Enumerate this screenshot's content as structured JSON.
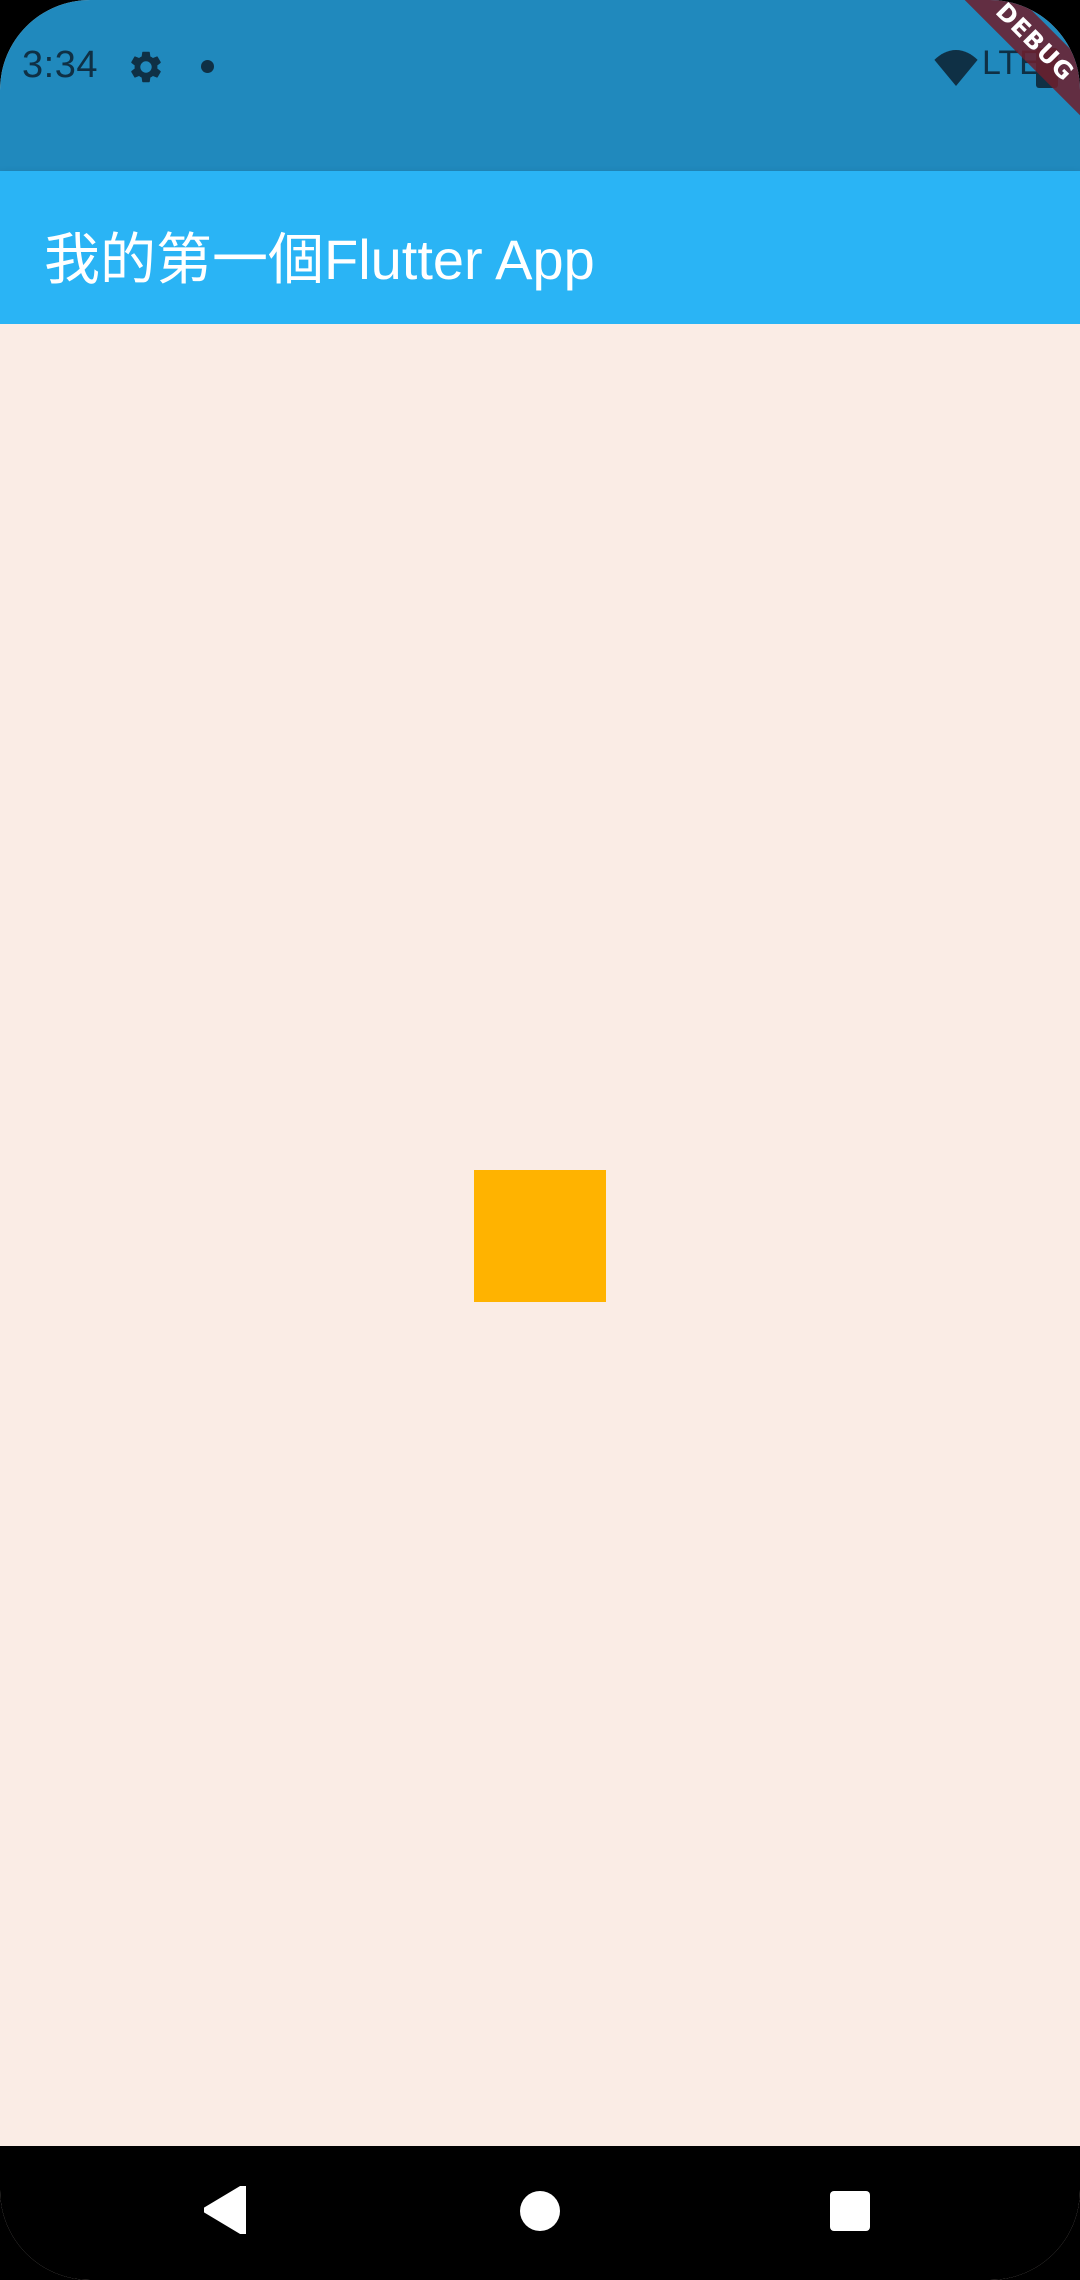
{
  "status_bar": {
    "time": "3:34",
    "network": "LTE",
    "icons": [
      "gear-icon",
      "notification-dot-icon",
      "wifi-icon",
      "battery-icon"
    ]
  },
  "debug_banner": {
    "label": "DEBUG"
  },
  "app_bar": {
    "title": "我的第一個Flutter App"
  },
  "content": {
    "square_color": "#FFB300"
  },
  "colors": {
    "status_bar": "#2089BD",
    "app_bar": "#2AB4F5",
    "background": "#FAECE5",
    "nav_bar": "#000000"
  },
  "nav_bar": {
    "buttons": [
      "back-icon",
      "home-icon",
      "recents-icon"
    ]
  }
}
